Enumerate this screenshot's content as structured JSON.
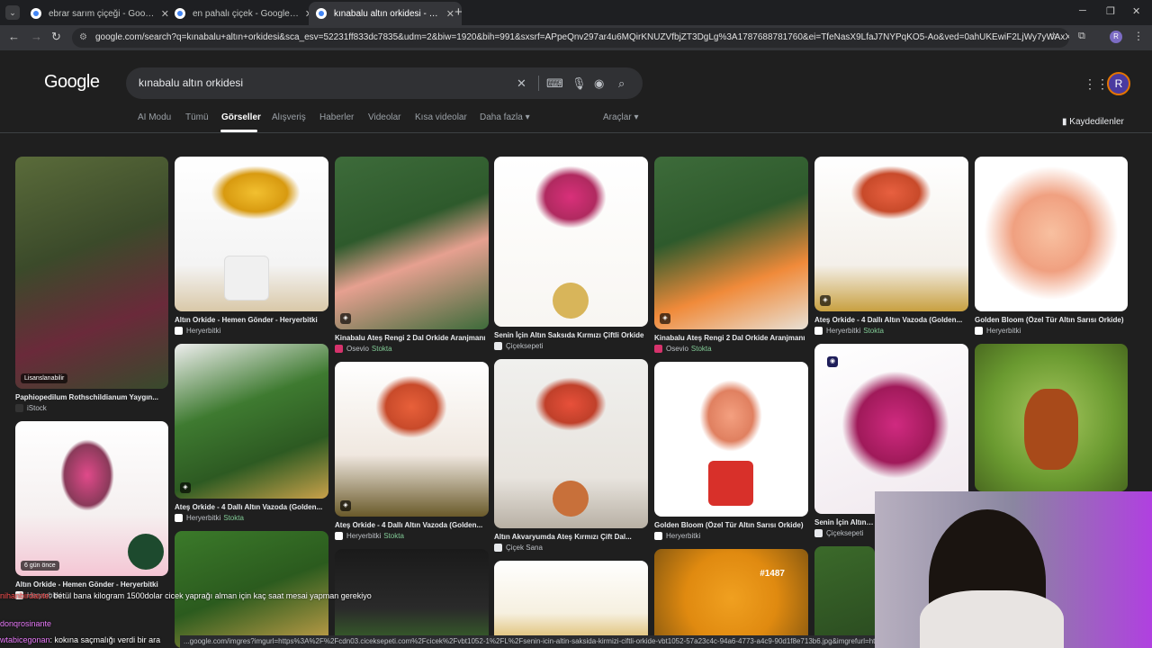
{
  "browser": {
    "tabs": [
      {
        "title": "ebrar sarım çiçeği - Google'da A"
      },
      {
        "title": "en pahalı çiçek - Google'da Ara"
      },
      {
        "title": "kınabalu altın orkidesi - Google"
      }
    ],
    "url": "google.com/search?q=kınabalu+altın+orkidesi&sca_esv=52231ff833dc7835&udm=2&biw=1920&bih=991&sxsrf=APpeQnv297ar4u6MQirKNUZVfbjZT3DgLg%3A1787688781760&ei=TfeNasX9LfaJ7NYPqKO5-Ao&ved=0ahUKEwiF2LjWy7yWAxX2BNsEHah...",
    "profile_initial": "R"
  },
  "google": {
    "logo": "Google",
    "query": "kınabalu altın orkidesi",
    "avatar_initial": "R",
    "nav": [
      "AI Modu",
      "Tümü",
      "Görseller",
      "Alışveriş",
      "Haberler",
      "Videolar",
      "Kısa videolar",
      "Daha fazla",
      "Araçlar"
    ],
    "saved": "Kaydedilenler"
  },
  "results": [
    {
      "cap": "Paphiopedilum Rothschildianum Yaygın...",
      "src": "iStock",
      "stock": "",
      "badge": "Lisanslanabilir"
    },
    {
      "cap": "Altın Orkide - Hemen Gönder - Heryerbitki",
      "src": "Heryerbitki",
      "stock": "",
      "badge": "6 gün önce"
    },
    {
      "cap": "Altın Orkide - Hemen Gönder - Heryerbitki",
      "src": "Heryerbitki",
      "stock": "",
      "badge": ""
    },
    {
      "cap": "Ateş Orkide - 4 Dallı Altın Vazoda (Golden...",
      "src": "Heryerbitki",
      "stock": "Stokta",
      "badge": ""
    },
    {
      "cap": "Kinabalu Ateş Rengi 2 Dal Orkide Aranjmanı",
      "src": "Osevio",
      "stock": "Stokta",
      "badge": ""
    },
    {
      "cap": "Ateş Orkide - 4 Dallı Altın Vazoda (Golden...",
      "src": "Heryerbitki",
      "stock": "Stokta",
      "badge": ""
    },
    {
      "cap": "Senin İçin Altın Saksıda Kırmızı Çiftli Orkide",
      "src": "Çiçeksepeti",
      "stock": "",
      "badge": ""
    },
    {
      "cap": "Altın Akvaryumda Ateş Kırmızı Çift Dal...",
      "src": "Çiçek Sana",
      "stock": "",
      "badge": ""
    },
    {
      "cap": "Kinabalu Ateş Rengi 2 Dal Orkide Aranjmanı",
      "src": "Osevio",
      "stock": "Stokta",
      "badge": ""
    },
    {
      "cap": "Golden Bloom (Özel Tür Altın Sarısı Orkide)",
      "src": "Heryerbitki",
      "stock": "",
      "badge": "#1487"
    },
    {
      "cap": "Ateş Orkide - 4 Dallı Altın Vazoda (Golden...",
      "src": "Heryerbitki",
      "stock": "Stokta",
      "badge": ""
    },
    {
      "cap": "Senin İçin Altın Sa",
      "src": "Çiçeksepeti",
      "stock": "",
      "badge": ""
    },
    {
      "cap": "Golden Bloom (Özel Tür Altın Sarısı Orkide)",
      "src": "Heryerbitki",
      "stock": "",
      "badge": ""
    }
  ],
  "chat": [
    {
      "user": "nihanbirdante",
      "msg": ": betül bana kilogram 1500dolar cicek yaprağı alman için kaç saat mesai yapman gerekiyo"
    },
    {
      "user": "donqrosinante",
      "msg": ""
    },
    {
      "user": "wtabicegonan",
      "msg": ": kokına saçmalığı verdi bir ara"
    }
  ],
  "status_url": "...google.com/imgres?imgurl=https%3A%2F%2Fcdn03.ciceksepeti.com%2Fcicek%2Fvbt1052-1%2FL%2Fsenin-icin-altin-saksida-kirmizi-ciftli-orkide-vbt1052-57a23c4c-94a6-4773-a4c9-90d1f8e713b6.jpg&imgrefurl=https%3A%2F%2Fwww"
}
